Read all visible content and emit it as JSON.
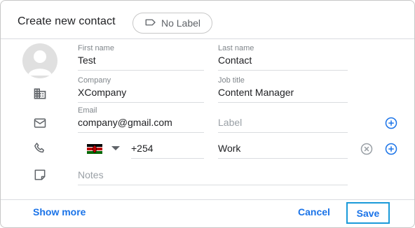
{
  "dialog": {
    "title": "Create new contact",
    "label_chip": "No Label"
  },
  "fields": {
    "first_name": {
      "label": "First name",
      "value": "Test"
    },
    "last_name": {
      "label": "Last name",
      "value": "Contact"
    },
    "company": {
      "label": "Company",
      "value": "XCompany"
    },
    "job_title": {
      "label": "Job title",
      "value": "Content Manager"
    },
    "email": {
      "label": "Email",
      "value": "company@gmail.com"
    },
    "email_label": {
      "placeholder": "Label"
    },
    "phone": {
      "country": "Kenya",
      "value": "+254"
    },
    "phone_label": {
      "value": "Work"
    },
    "notes": {
      "placeholder": "Notes"
    }
  },
  "footer": {
    "show_more": "Show more",
    "cancel": "Cancel",
    "save": "Save"
  },
  "colors": {
    "accent": "#1a73e8",
    "save_focus_border": "#1a9ad9"
  }
}
